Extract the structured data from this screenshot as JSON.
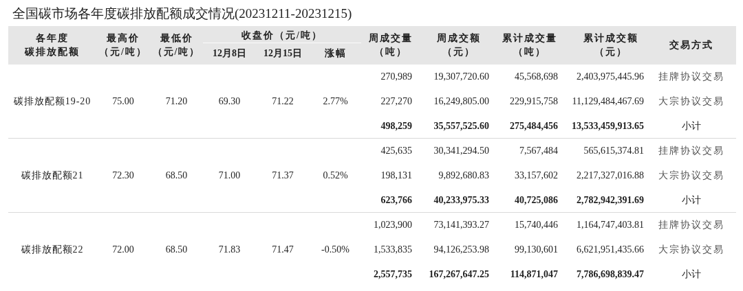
{
  "title": "全国碳市场各年度碳排放配额成交情况(20231211-20231215)",
  "header": {
    "allowance": [
      "各年度",
      "碳排放配额"
    ],
    "high": [
      "最高价",
      "（元/吨）"
    ],
    "low": [
      "最低价",
      "（元/吨）"
    ],
    "close": "收盘价（元/吨）",
    "close_dates": [
      "12月8日",
      "12月15日"
    ],
    "change": "涨幅",
    "weekly_volume": [
      "周成交量",
      "（吨）"
    ],
    "weekly_amount": [
      "周成交额",
      "（元）"
    ],
    "cumulative_volume": [
      "累计成交量",
      "（吨）"
    ],
    "cumulative_amount": [
      "累计成交额",
      "（元）"
    ],
    "method": "交易方式"
  },
  "groups": [
    {
      "name": "碳排放配额19-20",
      "high": "75.00",
      "low": "71.20",
      "close_dec8": "69.30",
      "close_dec15": "71.22",
      "change": "2.77%",
      "rows": [
        {
          "kind": "trade",
          "weekly_volume": "270,989",
          "weekly_amount": "19,307,720.60",
          "cumulative_volume": "45,568,698",
          "cumulative_amount": "2,403,975,445.96",
          "method": "挂牌协议交易"
        },
        {
          "kind": "trade",
          "weekly_volume": "227,270",
          "weekly_amount": "16,249,805.00",
          "cumulative_volume": "229,915,758",
          "cumulative_amount": "11,129,484,467.69",
          "method": "大宗协议交易"
        },
        {
          "kind": "subtotal",
          "weekly_volume": "498,259",
          "weekly_amount": "35,557,525.60",
          "cumulative_volume": "275,484,456",
          "cumulative_amount": "13,533,459,913.65",
          "method": "小计"
        }
      ]
    },
    {
      "name": "碳排放配额21",
      "high": "72.30",
      "low": "68.50",
      "close_dec8": "71.00",
      "close_dec15": "71.37",
      "change": "0.52%",
      "rows": [
        {
          "kind": "trade",
          "weekly_volume": "425,635",
          "weekly_amount": "30,341,294.50",
          "cumulative_volume": "7,567,484",
          "cumulative_amount": "565,615,374.81",
          "method": "挂牌协议交易"
        },
        {
          "kind": "trade",
          "weekly_volume": "198,131",
          "weekly_amount": "9,892,680.83",
          "cumulative_volume": "33,157,602",
          "cumulative_amount": "2,217,327,016.88",
          "method": "大宗协议交易"
        },
        {
          "kind": "subtotal",
          "weekly_volume": "623,766",
          "weekly_amount": "40,233,975.33",
          "cumulative_volume": "40,725,086",
          "cumulative_amount": "2,782,942,391.69",
          "method": "小计"
        }
      ]
    },
    {
      "name": "碳排放配额22",
      "high": "72.00",
      "low": "68.50",
      "close_dec8": "71.83",
      "close_dec15": "71.47",
      "change": "-0.50%",
      "rows": [
        {
          "kind": "trade",
          "weekly_volume": "1,023,900",
          "weekly_amount": "73,141,393.27",
          "cumulative_volume": "15,740,446",
          "cumulative_amount": "1,164,747,403.81",
          "method": "挂牌协议交易"
        },
        {
          "kind": "trade",
          "weekly_volume": "1,533,835",
          "weekly_amount": "94,126,253.98",
          "cumulative_volume": "99,130,601",
          "cumulative_amount": "6,621,951,435.66",
          "method": "大宗协议交易"
        },
        {
          "kind": "subtotal",
          "weekly_volume": "2,557,735",
          "weekly_amount": "167,267,647.25",
          "cumulative_volume": "114,871,047",
          "cumulative_amount": "7,786,698,839.47",
          "method": "小计"
        }
      ]
    }
  ]
}
